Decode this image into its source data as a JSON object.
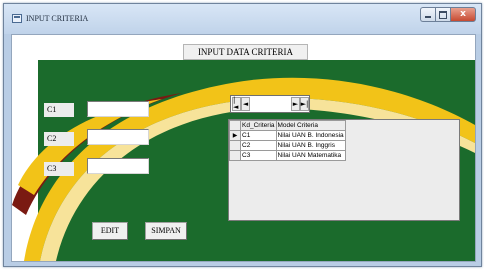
{
  "window": {
    "title": "INPUT CRITERIA"
  },
  "controls": {
    "minimize_icon": "minimize-icon",
    "maximize_icon": "maximize-icon",
    "close_icon": "close-icon",
    "close_glyph": "x"
  },
  "form": {
    "header": "INPUT DATA CRITERIA",
    "fields": [
      {
        "label": "C1",
        "value": ""
      },
      {
        "label": "C2",
        "value": ""
      },
      {
        "label": "C3",
        "value": ""
      }
    ]
  },
  "navigator": {
    "first": "|◄",
    "prev": "◄",
    "next": "►",
    "last": "►|"
  },
  "grid": {
    "columns": [
      "Kd_Criteria",
      "Model Criteria"
    ],
    "rows": [
      {
        "indicator": "▶",
        "kd": "C1",
        "model": "Nilai UAN B. Indonesia"
      },
      {
        "indicator": "",
        "kd": "C2",
        "model": "Nilai UAN B. Inggris"
      },
      {
        "indicator": "",
        "kd": "C3",
        "model": "Nilai UAN Matematika"
      }
    ]
  },
  "buttons": {
    "edit": "EDIT",
    "save": "SIMPAN"
  },
  "colors": {
    "green_band": "#1b6b2c",
    "swoosh_yellow": "#f2c318",
    "swoosh_red": "#7a1a12",
    "window_frame": "#b9cde5",
    "close_button": "#c64a31"
  }
}
